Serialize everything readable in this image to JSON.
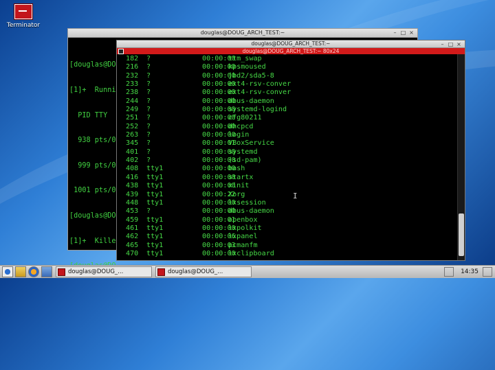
{
  "desktop": {
    "icon_label": "Terminator"
  },
  "back_window": {
    "title": "douglas@DOUG_ARCH_TEST:~",
    "lines": [
      "[douglas@DO",
      "[1]+  Runni",
      "  PID TTY",
      "  938 pts/0",
      "  999 pts/0",
      " 1001 pts/0",
      "[douglas@DO",
      "[1]+  Kille",
      "[douglas@DO"
    ]
  },
  "front_window": {
    "title": "douglas@DOUG_ARCH_TEST:~",
    "subtitle": "douglas@DOUG_ARCH_TEST:~ 80x24",
    "processes": [
      {
        "pid": "182",
        "tty": "?",
        "time": "00:00:00",
        "cmd": "ttm_swap"
      },
      {
        "pid": "216",
        "tty": "?",
        "time": "00:00:00",
        "cmd": "kpsmoused"
      },
      {
        "pid": "232",
        "tty": "?",
        "time": "00:00:00",
        "cmd": "jbd2/sda5-8"
      },
      {
        "pid": "233",
        "tty": "?",
        "time": "00:00:00",
        "cmd": "ext4-rsv-conver"
      },
      {
        "pid": "238",
        "tty": "?",
        "time": "00:00:00",
        "cmd": "ext4-rsv-conver"
      },
      {
        "pid": "244",
        "tty": "?",
        "time": "00:00:00",
        "cmd": "dbus-daemon"
      },
      {
        "pid": "249",
        "tty": "?",
        "time": "00:00:00",
        "cmd": "systemd-logind"
      },
      {
        "pid": "251",
        "tty": "?",
        "time": "00:00:00",
        "cmd": "cfg80211"
      },
      {
        "pid": "252",
        "tty": "?",
        "time": "00:00:00",
        "cmd": "dhcpcd"
      },
      {
        "pid": "263",
        "tty": "?",
        "time": "00:00:00",
        "cmd": "login"
      },
      {
        "pid": "345",
        "tty": "?",
        "time": "00:00:01",
        "cmd": "VBoxService"
      },
      {
        "pid": "401",
        "tty": "?",
        "time": "00:00:00",
        "cmd": "systemd"
      },
      {
        "pid": "402",
        "tty": "?",
        "time": "00:00:00",
        "cmd": "(sd-pam)"
      },
      {
        "pid": "408",
        "tty": "tty1",
        "time": "00:00:00",
        "cmd": "bash"
      },
      {
        "pid": "416",
        "tty": "tty1",
        "time": "00:00:00",
        "cmd": "startx"
      },
      {
        "pid": "438",
        "tty": "tty1",
        "time": "00:00:00",
        "cmd": "xinit"
      },
      {
        "pid": "439",
        "tty": "tty1",
        "time": "00:00:22",
        "cmd": "Xorg"
      },
      {
        "pid": "448",
        "tty": "tty1",
        "time": "00:00:00",
        "cmd": "lxsession"
      },
      {
        "pid": "453",
        "tty": "?",
        "time": "00:00:00",
        "cmd": "dbus-daemon"
      },
      {
        "pid": "459",
        "tty": "tty1",
        "time": "00:00:01",
        "cmd": "openbox"
      },
      {
        "pid": "461",
        "tty": "tty1",
        "time": "00:00:00",
        "cmd": "lxpolkit"
      },
      {
        "pid": "462",
        "tty": "tty1",
        "time": "00:00:06",
        "cmd": "lxpanel"
      },
      {
        "pid": "465",
        "tty": "tty1",
        "time": "00:00:03",
        "cmd": "pcmanfm"
      },
      {
        "pid": "470",
        "tty": "tty1",
        "time": "00:00:00",
        "cmd": "lxclipboard"
      }
    ]
  },
  "taskbar": {
    "tasks": [
      "douglas@DOUG_...",
      "douglas@DOUG_..."
    ],
    "clock": "14:35"
  }
}
